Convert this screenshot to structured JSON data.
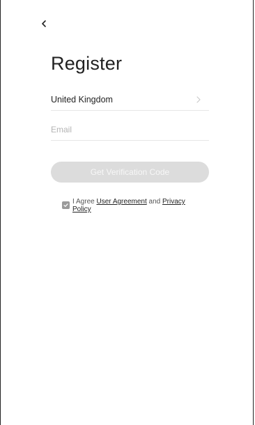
{
  "page": {
    "title": "Register"
  },
  "nav": {
    "back_icon": "chevron-left-icon"
  },
  "form": {
    "country": {
      "value": "United Kingdom",
      "icon": "chevron-right-icon"
    },
    "email": {
      "placeholder": "Email",
      "value": ""
    },
    "submit_label": "Get Verification Code"
  },
  "agreement": {
    "checked": true,
    "prefix": "I Agree",
    "user_agreement_link": "User Agreement",
    "conjunction": "and",
    "privacy_policy_link": "Privacy Policy"
  },
  "colors": {
    "text": "#222222",
    "placeholder": "#b4b4b4",
    "button_disabled_bg": "#dcdcdc",
    "button_disabled_text": "#f7f7f7",
    "divider": "#e6e6e6",
    "checkbox": "#9a9a9a"
  }
}
